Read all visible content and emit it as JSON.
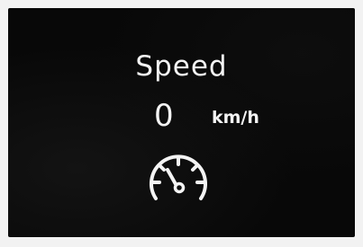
{
  "display": {
    "label": "Speed",
    "value": "0",
    "unit": "km/h",
    "icon": "speedometer-icon"
  },
  "colors": {
    "background": "#080808",
    "foreground": "#f4f4f4"
  }
}
